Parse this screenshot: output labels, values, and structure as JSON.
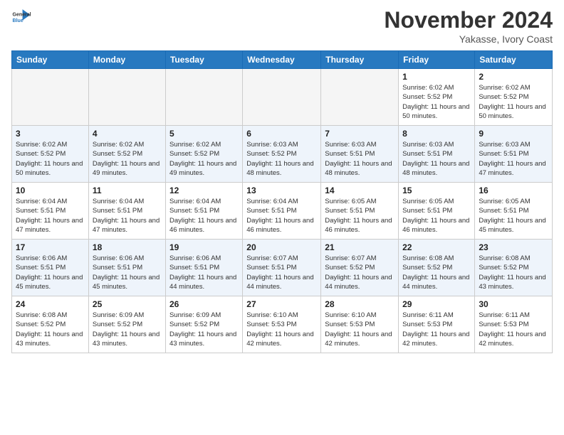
{
  "logo": {
    "line1": "General",
    "line2": "Blue"
  },
  "header": {
    "month": "November 2024",
    "location": "Yakasse, Ivory Coast"
  },
  "days_of_week": [
    "Sunday",
    "Monday",
    "Tuesday",
    "Wednesday",
    "Thursday",
    "Friday",
    "Saturday"
  ],
  "weeks": [
    [
      {
        "num": "",
        "empty": true
      },
      {
        "num": "",
        "empty": true
      },
      {
        "num": "",
        "empty": true
      },
      {
        "num": "",
        "empty": true
      },
      {
        "num": "",
        "empty": true
      },
      {
        "num": "1",
        "sunrise": "6:02 AM",
        "sunset": "5:52 PM",
        "daylight": "11 hours and 50 minutes."
      },
      {
        "num": "2",
        "sunrise": "6:02 AM",
        "sunset": "5:52 PM",
        "daylight": "11 hours and 50 minutes."
      }
    ],
    [
      {
        "num": "3",
        "sunrise": "6:02 AM",
        "sunset": "5:52 PM",
        "daylight": "11 hours and 50 minutes."
      },
      {
        "num": "4",
        "sunrise": "6:02 AM",
        "sunset": "5:52 PM",
        "daylight": "11 hours and 49 minutes."
      },
      {
        "num": "5",
        "sunrise": "6:02 AM",
        "sunset": "5:52 PM",
        "daylight": "11 hours and 49 minutes."
      },
      {
        "num": "6",
        "sunrise": "6:03 AM",
        "sunset": "5:52 PM",
        "daylight": "11 hours and 48 minutes."
      },
      {
        "num": "7",
        "sunrise": "6:03 AM",
        "sunset": "5:51 PM",
        "daylight": "11 hours and 48 minutes."
      },
      {
        "num": "8",
        "sunrise": "6:03 AM",
        "sunset": "5:51 PM",
        "daylight": "11 hours and 48 minutes."
      },
      {
        "num": "9",
        "sunrise": "6:03 AM",
        "sunset": "5:51 PM",
        "daylight": "11 hours and 47 minutes."
      }
    ],
    [
      {
        "num": "10",
        "sunrise": "6:04 AM",
        "sunset": "5:51 PM",
        "daylight": "11 hours and 47 minutes."
      },
      {
        "num": "11",
        "sunrise": "6:04 AM",
        "sunset": "5:51 PM",
        "daylight": "11 hours and 47 minutes."
      },
      {
        "num": "12",
        "sunrise": "6:04 AM",
        "sunset": "5:51 PM",
        "daylight": "11 hours and 46 minutes."
      },
      {
        "num": "13",
        "sunrise": "6:04 AM",
        "sunset": "5:51 PM",
        "daylight": "11 hours and 46 minutes."
      },
      {
        "num": "14",
        "sunrise": "6:05 AM",
        "sunset": "5:51 PM",
        "daylight": "11 hours and 46 minutes."
      },
      {
        "num": "15",
        "sunrise": "6:05 AM",
        "sunset": "5:51 PM",
        "daylight": "11 hours and 46 minutes."
      },
      {
        "num": "16",
        "sunrise": "6:05 AM",
        "sunset": "5:51 PM",
        "daylight": "11 hours and 45 minutes."
      }
    ],
    [
      {
        "num": "17",
        "sunrise": "6:06 AM",
        "sunset": "5:51 PM",
        "daylight": "11 hours and 45 minutes."
      },
      {
        "num": "18",
        "sunrise": "6:06 AM",
        "sunset": "5:51 PM",
        "daylight": "11 hours and 45 minutes."
      },
      {
        "num": "19",
        "sunrise": "6:06 AM",
        "sunset": "5:51 PM",
        "daylight": "11 hours and 44 minutes."
      },
      {
        "num": "20",
        "sunrise": "6:07 AM",
        "sunset": "5:51 PM",
        "daylight": "11 hours and 44 minutes."
      },
      {
        "num": "21",
        "sunrise": "6:07 AM",
        "sunset": "5:52 PM",
        "daylight": "11 hours and 44 minutes."
      },
      {
        "num": "22",
        "sunrise": "6:08 AM",
        "sunset": "5:52 PM",
        "daylight": "11 hours and 44 minutes."
      },
      {
        "num": "23",
        "sunrise": "6:08 AM",
        "sunset": "5:52 PM",
        "daylight": "11 hours and 43 minutes."
      }
    ],
    [
      {
        "num": "24",
        "sunrise": "6:08 AM",
        "sunset": "5:52 PM",
        "daylight": "11 hours and 43 minutes."
      },
      {
        "num": "25",
        "sunrise": "6:09 AM",
        "sunset": "5:52 PM",
        "daylight": "11 hours and 43 minutes."
      },
      {
        "num": "26",
        "sunrise": "6:09 AM",
        "sunset": "5:52 PM",
        "daylight": "11 hours and 43 minutes."
      },
      {
        "num": "27",
        "sunrise": "6:10 AM",
        "sunset": "5:53 PM",
        "daylight": "11 hours and 42 minutes."
      },
      {
        "num": "28",
        "sunrise": "6:10 AM",
        "sunset": "5:53 PM",
        "daylight": "11 hours and 42 minutes."
      },
      {
        "num": "29",
        "sunrise": "6:11 AM",
        "sunset": "5:53 PM",
        "daylight": "11 hours and 42 minutes."
      },
      {
        "num": "30",
        "sunrise": "6:11 AM",
        "sunset": "5:53 PM",
        "daylight": "11 hours and 42 minutes."
      }
    ]
  ],
  "labels": {
    "sunrise": "Sunrise:",
    "sunset": "Sunset:",
    "daylight": "Daylight:"
  }
}
